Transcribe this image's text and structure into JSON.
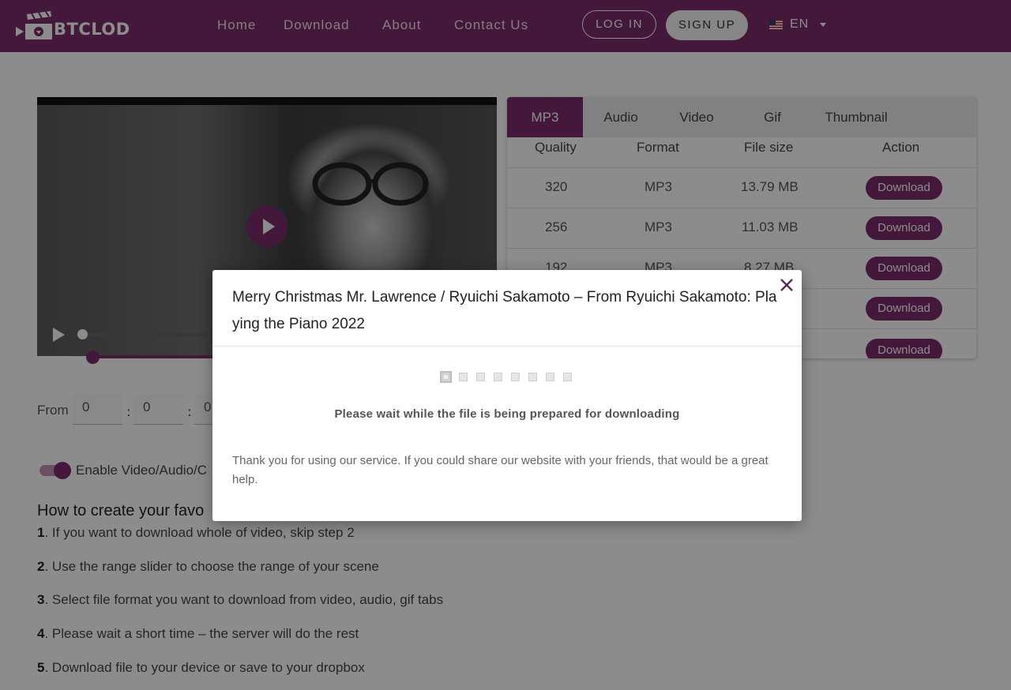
{
  "brand": {
    "name": "BTCLOD"
  },
  "nav": {
    "links": [
      "Home",
      "Download",
      "About",
      "Contact Us"
    ],
    "login_label": "LOG IN",
    "signup_label": "SIGN UP",
    "language": "EN"
  },
  "colors": {
    "accent": "#7b2d6b",
    "nav_bg": "#7b2d6b",
    "overlay": "rgba(0,0,0,0.45)"
  },
  "video": {
    "icons": [
      "play-icon",
      "play-control-icon"
    ],
    "progress": 0
  },
  "formats": {
    "tabs": [
      "MP3",
      "Audio",
      "Video",
      "Gif",
      "Thumbnail"
    ],
    "active_tab": "MP3",
    "headers": {
      "quality": "Quality",
      "format": "Format",
      "size": "File size",
      "action": "Action"
    },
    "rows": [
      {
        "quality": "320",
        "format": "MP3",
        "size": "13.79 MB",
        "action": "Download"
      },
      {
        "quality": "256",
        "format": "MP3",
        "size": "11.03 MB",
        "action": "Download"
      },
      {
        "quality": "192",
        "format": "MP3",
        "size": "8.27 MB",
        "action": "Download"
      },
      {
        "quality": "",
        "format": "",
        "size": "",
        "action": "Download"
      },
      {
        "quality": "",
        "format": "",
        "size": "",
        "action": "Download"
      }
    ]
  },
  "trim": {
    "from_label": "From",
    "values": [
      "0",
      "0",
      "0"
    ],
    "separator": ":"
  },
  "toggle": {
    "label": "Enable Video/Audio/C",
    "on": true
  },
  "howto": {
    "title": "How to create your favo",
    "steps": [
      {
        "num": "1",
        "text": ". If you want to download whole of video, skip step 2"
      },
      {
        "num": "2",
        "text": ". Use the range slider to choose the range of your scene"
      },
      {
        "num": "3",
        "text": ". Select file format you want to download from video, audio, gif tabs"
      },
      {
        "num": "4",
        "text": ". Please wait a short time – the server will do the rest"
      },
      {
        "num": "5",
        "text": ". Download file to your device or save to your dropbox"
      }
    ]
  },
  "modal": {
    "title": "Merry Christmas Mr. Lawrence / Ryuichi Sakamoto – From Ryuichi Sakamoto: Playing the Piano 2022",
    "status": "Please wait while the file is being prepared for downloading",
    "thanks": "Thank you for using our service. If you could share our website with your friends, that would be a great help.",
    "close_icon": "close-icon",
    "progress_steps": 8,
    "progress_active": 1
  }
}
